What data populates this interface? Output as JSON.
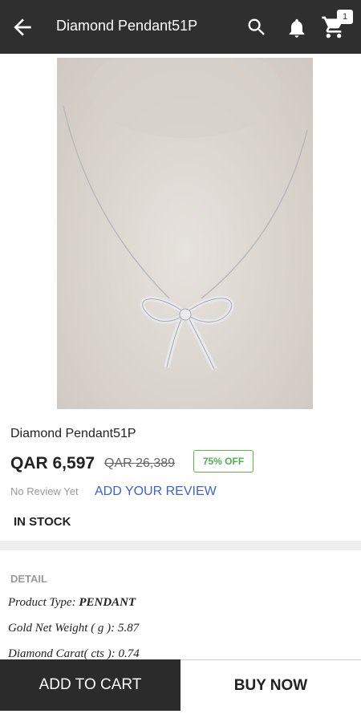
{
  "header": {
    "title": "Diamond Pendant51P",
    "cart_count": "1",
    "icons": [
      "back-arrow-icon",
      "search-icon",
      "bell-icon",
      "cart-icon"
    ]
  },
  "product": {
    "name": "Diamond Pendant51P",
    "price": "QAR 6,597",
    "mrp": "QAR 26,389",
    "discount": "75% OFF",
    "review_status": "No Review Yet",
    "add_review": "ADD YOUR REVIEW",
    "stock": "IN STOCK"
  },
  "detail": {
    "heading": "DETAIL",
    "rows": [
      {
        "label": "Product Type: ",
        "value": "PENDANT"
      },
      {
        "label": "Gold Net Weight ( g ): ",
        "value": "5.87"
      },
      {
        "label": "Diamond Carat( cts ): ",
        "value": "0.74"
      }
    ]
  },
  "actions": {
    "add_to_cart": "ADD TO CART",
    "buy_now": "BUY NOW"
  },
  "colors": {
    "appbar": "#2f2f2f",
    "accent_link": "#3a62d6",
    "discount_green": "#4caf50"
  }
}
